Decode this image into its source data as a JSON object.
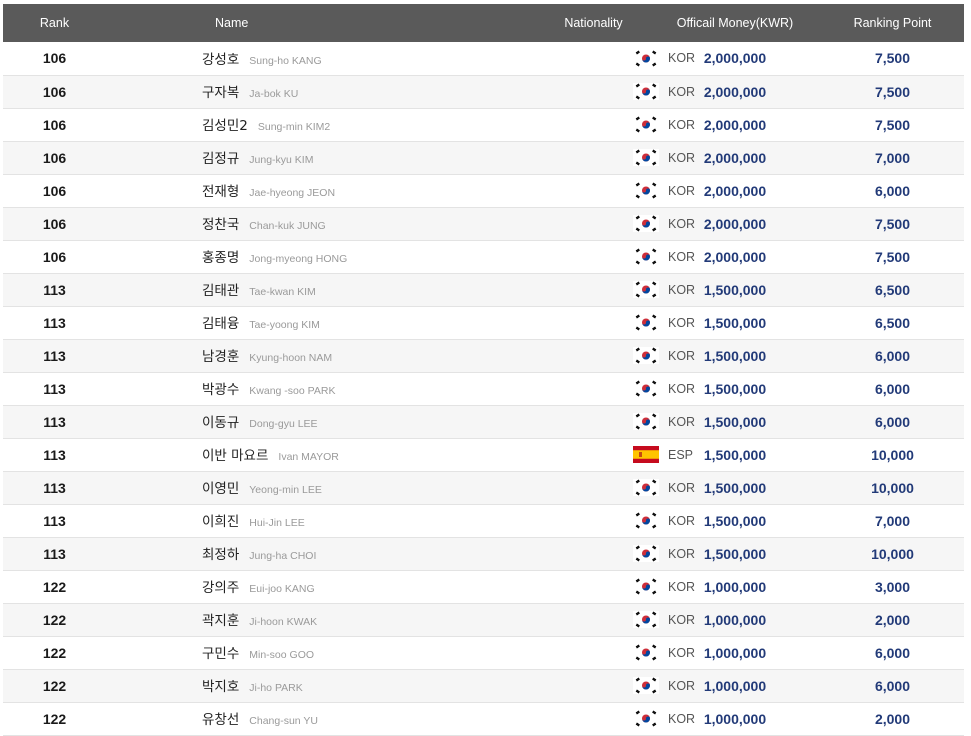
{
  "headers": {
    "rank": "Rank",
    "name": "Name",
    "nationality": "Nationality",
    "money": "Officail Money(KWR)",
    "points": "Ranking Point"
  },
  "rows": [
    {
      "rank": "106",
      "name_kr": "강성호",
      "name_en": "Sung-ho KANG",
      "flag": "kor-flag-icon",
      "nation": "KOR",
      "money": "2,000,000",
      "points": "7,500"
    },
    {
      "rank": "106",
      "name_kr": "구자복",
      "name_en": "Ja-bok KU",
      "flag": "kor-flag-icon",
      "nation": "KOR",
      "money": "2,000,000",
      "points": "7,500"
    },
    {
      "rank": "106",
      "name_kr": "김성민2",
      "name_en": "Sung-min KIM2",
      "flag": "kor-flag-icon",
      "nation": "KOR",
      "money": "2,000,000",
      "points": "7,500"
    },
    {
      "rank": "106",
      "name_kr": "김정규",
      "name_en": "Jung-kyu KIM",
      "flag": "kor-flag-icon",
      "nation": "KOR",
      "money": "2,000,000",
      "points": "7,000"
    },
    {
      "rank": "106",
      "name_kr": "전재형",
      "name_en": "Jae-hyeong JEON",
      "flag": "kor-flag-icon",
      "nation": "KOR",
      "money": "2,000,000",
      "points": "6,000"
    },
    {
      "rank": "106",
      "name_kr": "정찬국",
      "name_en": "Chan-kuk JUNG",
      "flag": "kor-flag-icon",
      "nation": "KOR",
      "money": "2,000,000",
      "points": "7,500"
    },
    {
      "rank": "106",
      "name_kr": "홍종명",
      "name_en": "Jong-myeong HONG",
      "flag": "kor-flag-icon",
      "nation": "KOR",
      "money": "2,000,000",
      "points": "7,500"
    },
    {
      "rank": "113",
      "name_kr": "김태관",
      "name_en": "Tae-kwan KIM",
      "flag": "kor-flag-icon",
      "nation": "KOR",
      "money": "1,500,000",
      "points": "6,500"
    },
    {
      "rank": "113",
      "name_kr": "김태융",
      "name_en": "Tae-yoong KIM",
      "flag": "kor-flag-icon",
      "nation": "KOR",
      "money": "1,500,000",
      "points": "6,500"
    },
    {
      "rank": "113",
      "name_kr": "남경훈",
      "name_en": "Kyung-hoon NAM",
      "flag": "kor-flag-icon",
      "nation": "KOR",
      "money": "1,500,000",
      "points": "6,000"
    },
    {
      "rank": "113",
      "name_kr": "박광수",
      "name_en": "Kwang -soo PARK",
      "flag": "kor-flag-icon",
      "nation": "KOR",
      "money": "1,500,000",
      "points": "6,000"
    },
    {
      "rank": "113",
      "name_kr": "이동규",
      "name_en": "Dong-gyu LEE",
      "flag": "kor-flag-icon",
      "nation": "KOR",
      "money": "1,500,000",
      "points": "6,000"
    },
    {
      "rank": "113",
      "name_kr": "이반 마요르",
      "name_en": "Ivan MAYOR",
      "flag": "esp-flag-icon",
      "nation": "ESP",
      "money": "1,500,000",
      "points": "10,000"
    },
    {
      "rank": "113",
      "name_kr": "이영민",
      "name_en": "Yeong-min LEE",
      "flag": "kor-flag-icon",
      "nation": "KOR",
      "money": "1,500,000",
      "points": "10,000"
    },
    {
      "rank": "113",
      "name_kr": "이희진",
      "name_en": "Hui-Jin LEE",
      "flag": "kor-flag-icon",
      "nation": "KOR",
      "money": "1,500,000",
      "points": "7,000"
    },
    {
      "rank": "113",
      "name_kr": "최정하",
      "name_en": "Jung-ha CHOI",
      "flag": "kor-flag-icon",
      "nation": "KOR",
      "money": "1,500,000",
      "points": "10,000"
    },
    {
      "rank": "122",
      "name_kr": "강의주",
      "name_en": "Eui-joo KANG",
      "flag": "kor-flag-icon",
      "nation": "KOR",
      "money": "1,000,000",
      "points": "3,000"
    },
    {
      "rank": "122",
      "name_kr": "곽지훈",
      "name_en": "Ji-hoon KWAK",
      "flag": "kor-flag-icon",
      "nation": "KOR",
      "money": "1,000,000",
      "points": "2,000"
    },
    {
      "rank": "122",
      "name_kr": "구민수",
      "name_en": "Min-soo GOO",
      "flag": "kor-flag-icon",
      "nation": "KOR",
      "money": "1,000,000",
      "points": "6,000"
    },
    {
      "rank": "122",
      "name_kr": "박지호",
      "name_en": "Ji-ho PARK",
      "flag": "kor-flag-icon",
      "nation": "KOR",
      "money": "1,000,000",
      "points": "6,000"
    },
    {
      "rank": "122",
      "name_kr": "유창선",
      "name_en": "Chang-sun YU",
      "flag": "kor-flag-icon",
      "nation": "KOR",
      "money": "1,000,000",
      "points": "2,000"
    }
  ],
  "colors": {
    "header_bg": "#5a5a5a",
    "value_text": "#223a78",
    "row_alt_bg": "#f6f6f6"
  }
}
